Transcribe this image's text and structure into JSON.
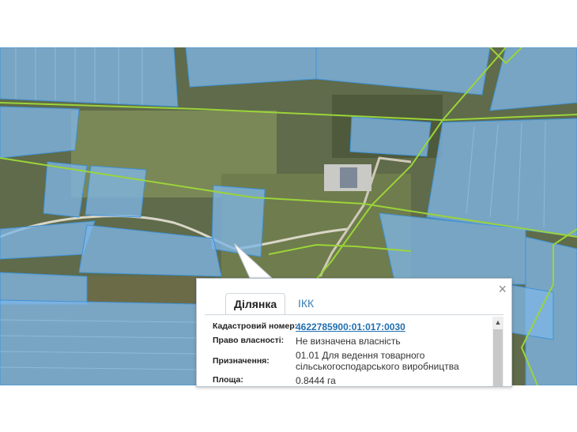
{
  "popup": {
    "close_glyph": "×",
    "tabs": [
      {
        "label": "Ділянка",
        "active": true
      },
      {
        "label": "ІКК",
        "active": false
      }
    ],
    "rows": [
      {
        "label": "Кадастровий номер:",
        "value": "4622785900:01:017:0030"
      },
      {
        "label": "Право власності:",
        "value": "Не визначена власність"
      },
      {
        "label": "Призначення:",
        "value_line1": "01.01 Для ведення товарного",
        "value_line2": "сільськогосподарського виробництва"
      },
      {
        "label": "Площа:",
        "value": "0.8444 га"
      }
    ]
  },
  "colors": {
    "parcel_fill": "#7fb6e6",
    "parcel_stroke": "#3f92d8",
    "boundary": "#9bd43a",
    "link": "#1f6fb0",
    "tab_inactive": "#3a7fb5"
  }
}
